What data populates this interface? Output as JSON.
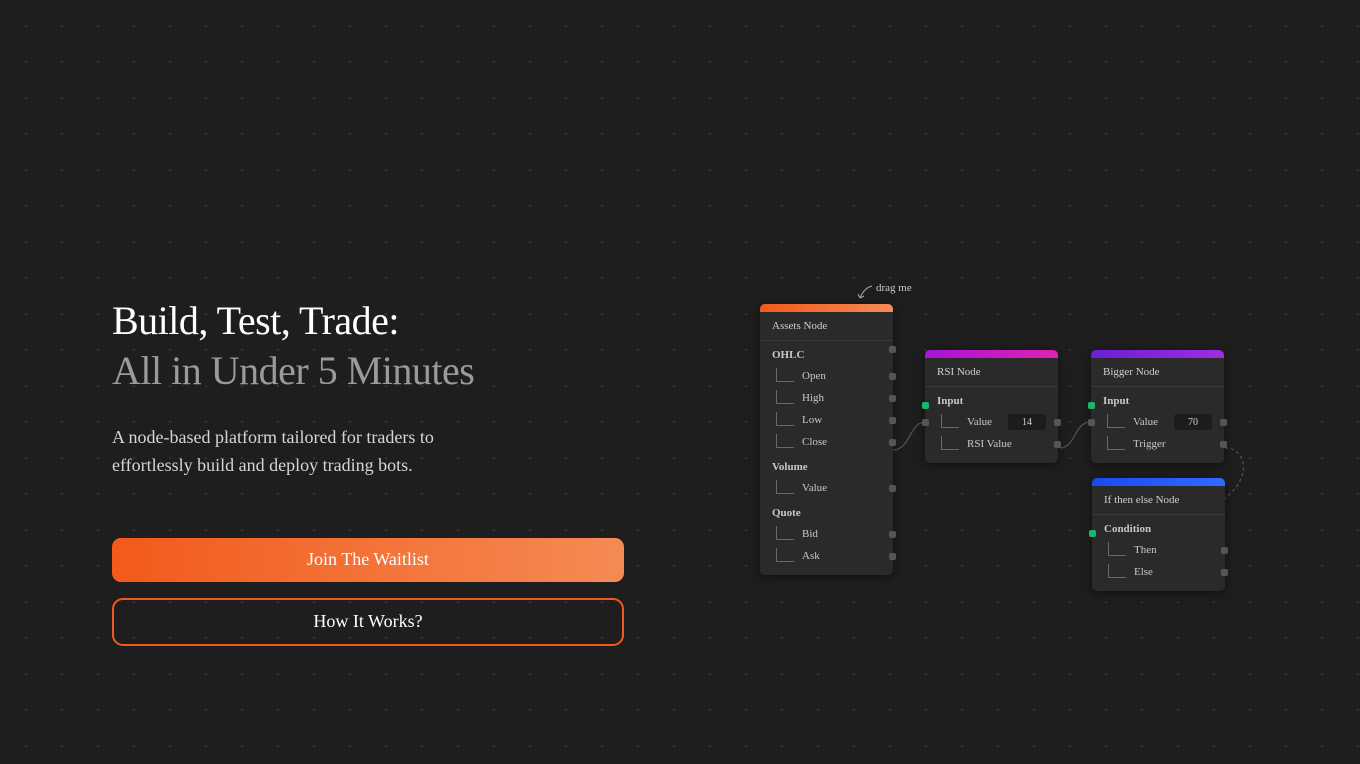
{
  "hero": {
    "title_line1": "Build, Test, Trade:",
    "title_line2": "All in Under 5 Minutes",
    "description": "A node-based platform tailored for traders to effortlessly build and deploy trading bots.",
    "join_label": "Join The Waitlist",
    "how_label": "How It Works?"
  },
  "hint": {
    "drag": "drag me"
  },
  "nodes": {
    "assets": {
      "title": "Assets Node",
      "sections": {
        "ohlc": {
          "label": "OHLC",
          "rows": [
            "Open",
            "High",
            "Low",
            "Close"
          ]
        },
        "volume": {
          "label": "Volume",
          "rows": [
            "Value"
          ]
        },
        "quote": {
          "label": "Quote",
          "rows": [
            "Bid",
            "Ask"
          ]
        }
      }
    },
    "rsi": {
      "title": "RSI Node",
      "input_label": "Input",
      "value_label": "Value",
      "value": "14",
      "output_label": "RSI Value"
    },
    "bigger": {
      "title": "Bigger Node",
      "input_label": "Input",
      "value_label": "Value",
      "value": "70",
      "trigger_label": "Trigger"
    },
    "ifelse": {
      "title": "If then else Node",
      "condition_label": "Condition",
      "then_label": "Then",
      "else_label": "Else"
    }
  }
}
